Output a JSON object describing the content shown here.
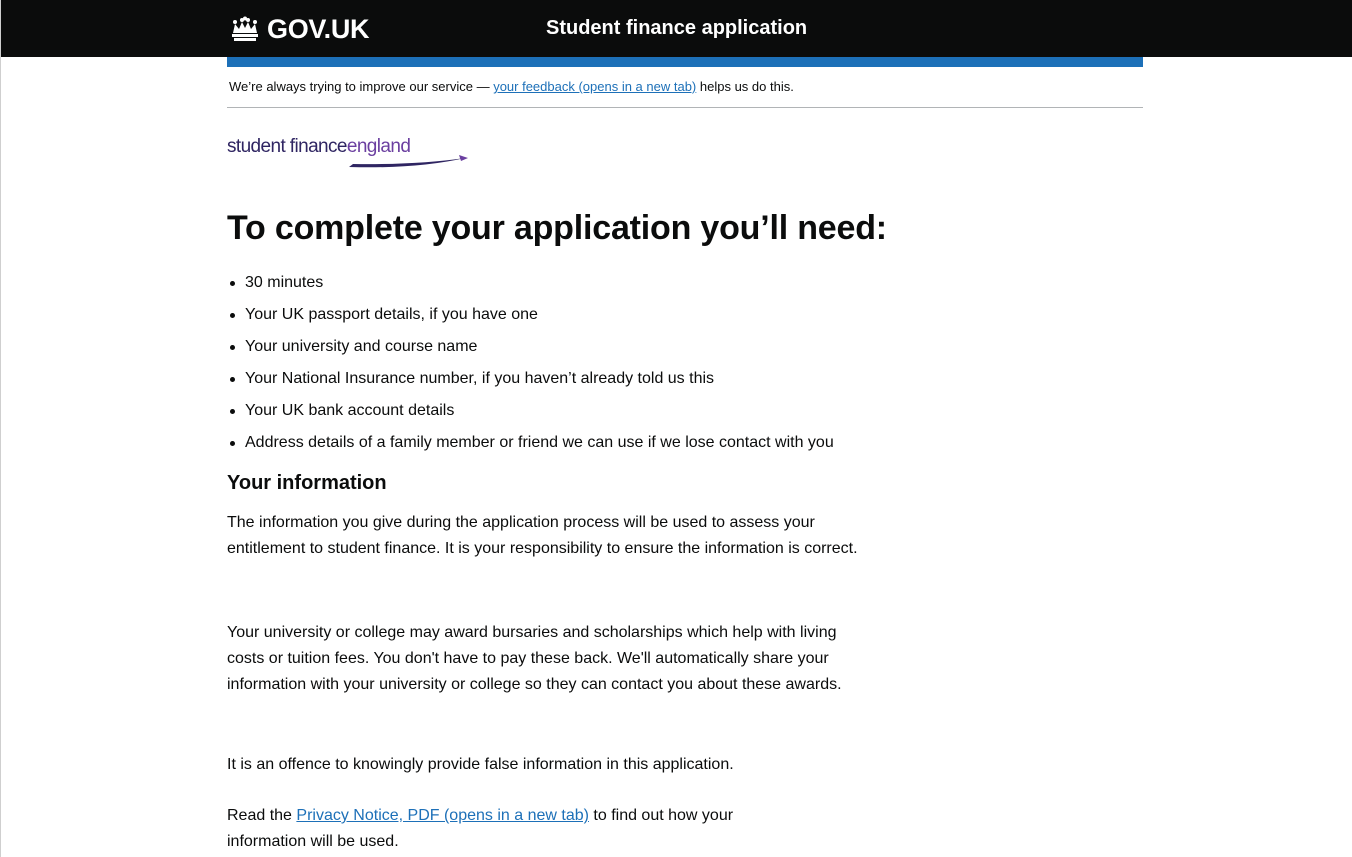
{
  "header": {
    "logo_text": "GOV.UK",
    "service_name": "Student finance application"
  },
  "feedback": {
    "text_before": "We’re always trying to improve our service — ",
    "link_text": "your feedback (opens in a new tab)",
    "text_after": " helps us do this."
  },
  "brand_logo": {
    "part1": "student finance",
    "part2": "england"
  },
  "main": {
    "heading": "To complete your application you’ll need:",
    "needs": [
      "30 minutes",
      "Your UK passport details, if you have one",
      "Your university and course name",
      "Your National Insurance number, if you haven’t already told us this",
      "Your UK bank account details",
      "Address details of a family member or friend we can use if we lose contact with you"
    ],
    "info_heading": "Your information",
    "para1": "The information you give during the application process will be used to assess your entitlement to student finance. It is your responsibility to ensure the information is correct.",
    "para2": "Your university or college may award bursaries and scholarships which help with living costs or tuition fees. You don't have to pay these back. We'll automatically share your information with your university or college so they can contact you about these awards.",
    "para3": "It is an offence to knowingly provide false information in this application.",
    "privacy_before": "Read the ",
    "privacy_link": "Privacy Notice, PDF (opens in a new tab)",
    "privacy_after": " to find out how your information will be used."
  },
  "colors": {
    "header_bg": "#0b0c0c",
    "brand_blue": "#1d70b8",
    "link": "#1d70b8",
    "text": "#0b0c0c",
    "sfe_navy": "#2f2562",
    "sfe_purple": "#6b3fa0"
  },
  "icons": {
    "logo_icon": "crown-icon"
  }
}
